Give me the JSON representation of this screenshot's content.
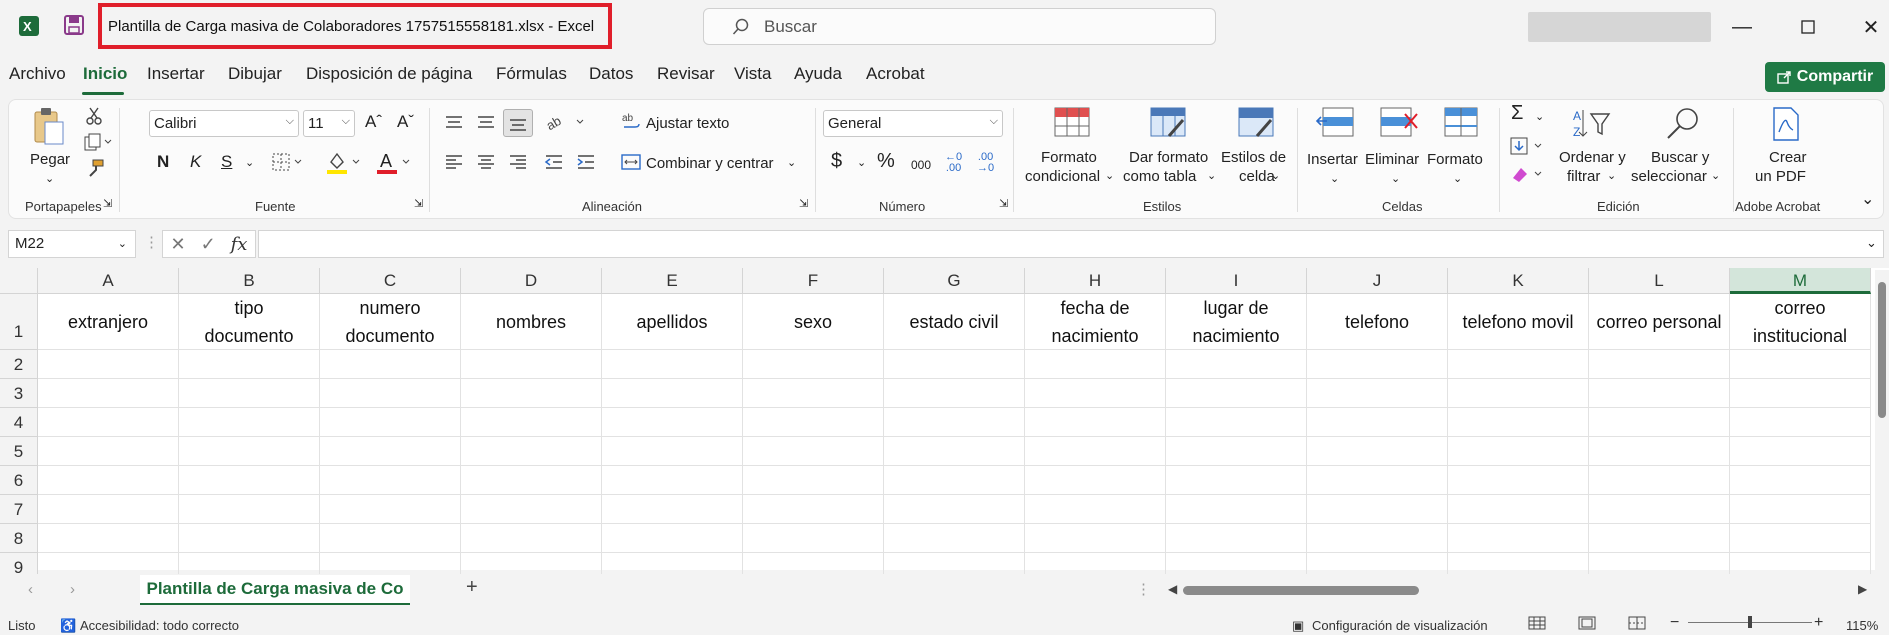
{
  "window": {
    "title": "Plantilla de Carga masiva de Colaboradores 1757515558181.xlsx  -  Excel",
    "search_placeholder": "Buscar",
    "accent": "#1d6b3a",
    "highlight": "#e01e2a"
  },
  "menu": {
    "items": [
      "Archivo",
      "Inicio",
      "Insertar",
      "Dibujar",
      "Disposición de página",
      "Fórmulas",
      "Datos",
      "Revisar",
      "Vista",
      "Ayuda",
      "Acrobat"
    ],
    "active": "Inicio",
    "share": "Compartir"
  },
  "ribbon": {
    "portapapeles": {
      "paste": "Pegar",
      "label": "Portapapeles"
    },
    "fuente": {
      "font": "Calibri",
      "size": "11",
      "bold": "N",
      "italic": "K",
      "underline": "S",
      "label": "Fuente"
    },
    "alineacion": {
      "wrap": "Ajustar texto",
      "merge": "Combinar y centrar",
      "label": "Alineación"
    },
    "numero": {
      "format": "General",
      "label": "Número",
      "thousands": "000"
    },
    "estilos": {
      "cond_1": "Formato",
      "cond_2": "condicional",
      "table_1": "Dar formato",
      "table_2": "como tabla",
      "cell_1": "Estilos de",
      "cell_2": "celda",
      "label": "Estilos"
    },
    "celdas": {
      "insert": "Insertar",
      "delete": "Eliminar",
      "format": "Formato",
      "label": "Celdas"
    },
    "edicion": {
      "sort_1": "Ordenar y",
      "sort_2": "filtrar",
      "find_1": "Buscar y",
      "find_2": "seleccionar",
      "label": "Edición"
    },
    "acrobat": {
      "pdf_1": "Crear",
      "pdf_2": "un PDF",
      "label": "Adobe Acrobat"
    }
  },
  "formula_bar": {
    "name_box": "M22",
    "fx": "fx",
    "value": ""
  },
  "sheet": {
    "columns": [
      "A",
      "B",
      "C",
      "D",
      "E",
      "F",
      "G",
      "H",
      "I",
      "J",
      "K",
      "L",
      "M"
    ],
    "selected_column": "M",
    "rows": [
      "1",
      "2",
      "3",
      "4",
      "5",
      "6",
      "7",
      "8",
      "9"
    ],
    "headers": [
      [
        "extranjero"
      ],
      [
        "tipo",
        "documento"
      ],
      [
        "numero",
        "documento"
      ],
      [
        "nombres"
      ],
      [
        "apellidos"
      ],
      [
        "sexo"
      ],
      [
        "estado civil"
      ],
      [
        "fecha de",
        "nacimiento"
      ],
      [
        "lugar de",
        "nacimiento"
      ],
      [
        "telefono"
      ],
      [
        "telefono movil"
      ],
      [
        "correo personal"
      ],
      [
        "correo",
        "institucional"
      ]
    ]
  },
  "tabs": {
    "active": "Plantilla de Carga masiva de Co",
    "add": "+"
  },
  "status": {
    "ready": "Listo",
    "accessibility": "Accesibilidad: todo correcto",
    "display_settings": "Configuración de visualización",
    "zoom": "115%"
  }
}
